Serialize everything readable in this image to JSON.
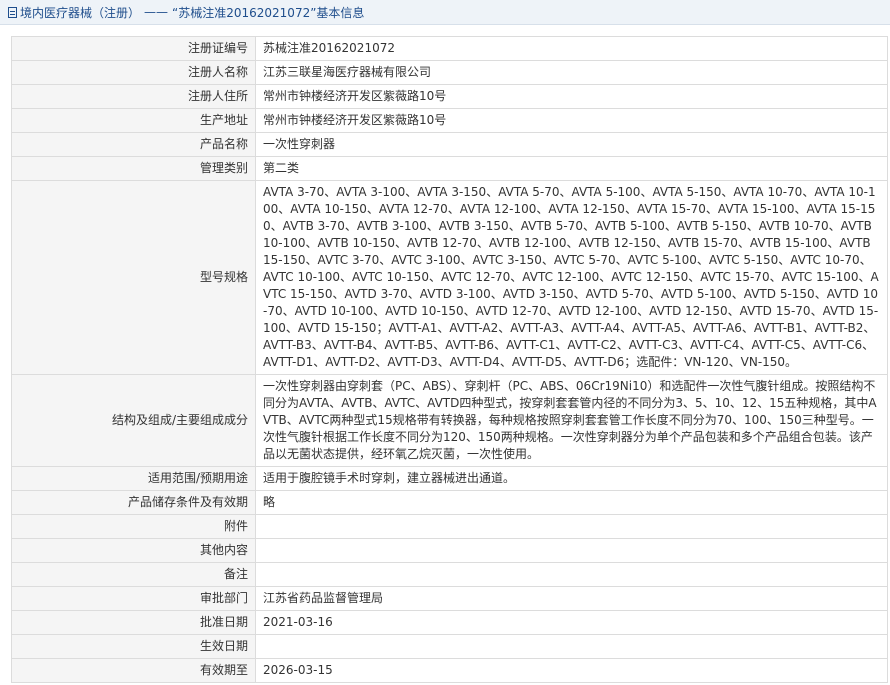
{
  "header": {
    "breadcrumb_root": "境内医疗器械（注册）",
    "separator": "——",
    "title": "“苏械注准20162021072”基本信息"
  },
  "rows": [
    {
      "label": "注册证编号",
      "value": "苏械注准20162021072"
    },
    {
      "label": "注册人名称",
      "value": "江苏三联星海医疗器械有限公司"
    },
    {
      "label": "注册人住所",
      "value": "常州市钟楼经济开发区紫薇路10号"
    },
    {
      "label": "生产地址",
      "value": "常州市钟楼经济开发区紫薇路10号"
    },
    {
      "label": "产品名称",
      "value": "一次性穿刺器"
    },
    {
      "label": "管理类别",
      "value": "第二类"
    },
    {
      "label": "型号规格",
      "value": "AVTA 3-70、AVTA 3-100、AVTA 3-150、AVTA 5-70、AVTA 5-100、AVTA 5-150、AVTA 10-70、AVTA 10-100、AVTA 10-150、AVTA 12-70、AVTA 12-100、AVTA 12-150、AVTA 15-70、AVTA 15-100、AVTA 15-150、AVTB 3-70、AVTB 3-100、AVTB 3-150、AVTB 5-70、AVTB 5-100、AVTB 5-150、AVTB 10-70、AVTB 10-100、AVTB 10-150、AVTB 12-70、AVTB 12-100、AVTB 12-150、AVTB 15-70、AVTB 15-100、AVTB 15-150、AVTC 3-70、AVTC 3-100、AVTC 3-150、AVTC 5-70、AVTC 5-100、AVTC 5-150、AVTC 10-70、AVTC 10-100、AVTC 10-150、AVTC 12-70、AVTC 12-100、AVTC 12-150、AVTC 15-70、AVTC 15-100、AVTC 15-150、AVTD 3-70、AVTD 3-100、AVTD 3-150、AVTD 5-70、AVTD 5-100、AVTD 5-150、AVTD 10-70、AVTD 10-100、AVTD 10-150、AVTD 12-70、AVTD 12-100、AVTD 12-150、AVTD 15-70、AVTD 15-100、AVTD 15-150；AVTT-A1、AVTT-A2、AVTT-A3、AVTT-A4、AVTT-A5、AVTT-A6、AVTT-B1、AVTT-B2、AVTT-B3、AVTT-B4、AVTT-B5、AVTT-B6、AVTT-C1、AVTT-C2、AVTT-C3、AVTT-C4、AVTT-C5、AVTT-C6、AVTT-D1、AVTT-D2、AVTT-D3、AVTT-D4、AVTT-D5、AVTT-D6；选配件：VN-120、VN-150。"
    },
    {
      "label": "结构及组成/主要组成成分",
      "value": "一次性穿刺器由穿刺套（PC、ABS）、穿刺杆（PC、ABS、06Cr19Ni10）和选配件一次性气腹针组成。按照结构不同分为AVTA、AVTB、AVTC、AVTD四种型式，按穿刺套套管内径的不同分为3、5、10、12、15五种规格，其中AVTB、AVTC两种型式15规格带有转换器，每种规格按照穿刺套套管工作长度不同分为70、100、150三种型号。一次性气腹针根据工作长度不同分为120、150两种规格。一次性穿刺器分为单个产品包装和多个产品组合包装。该产品以无菌状态提供，经环氧乙烷灭菌，一次性使用。"
    },
    {
      "label": "适用范围/预期用途",
      "value": "适用于腹腔镜手术时穿刺，建立器械进出通道。"
    },
    {
      "label": "产品储存条件及有效期",
      "value": "略"
    },
    {
      "label": "附件",
      "value": ""
    },
    {
      "label": "其他内容",
      "value": ""
    },
    {
      "label": "备注",
      "value": ""
    },
    {
      "label": "审批部门",
      "value": "江苏省药品监督管理局"
    },
    {
      "label": "批准日期",
      "value": "2021-03-16"
    },
    {
      "label": "生效日期",
      "value": ""
    },
    {
      "label": "有效期至",
      "value": "2026-03-15"
    }
  ]
}
